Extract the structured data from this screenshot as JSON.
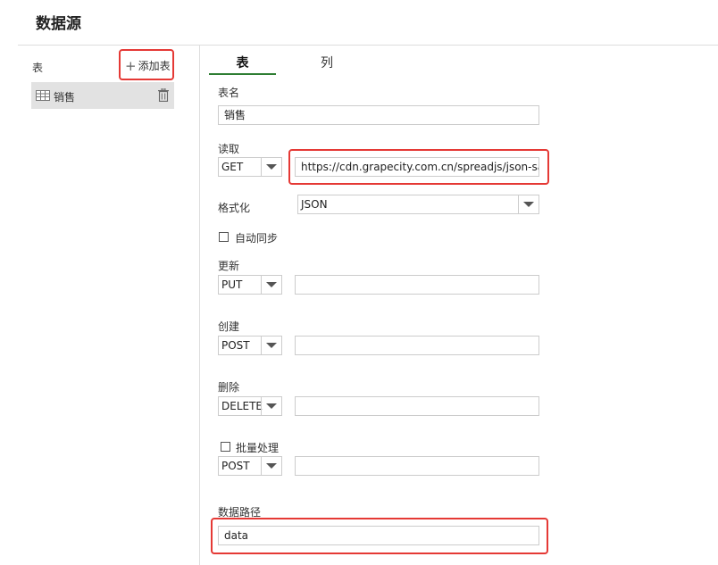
{
  "page": {
    "title": "数据源"
  },
  "sidebar": {
    "header_label": "表",
    "add_table_label": "添加表",
    "tables": [
      {
        "name": "销售"
      }
    ]
  },
  "tabs": [
    {
      "label": "表"
    },
    {
      "label": "列"
    }
  ],
  "form": {
    "table_name": {
      "label": "表名",
      "value": "销售"
    },
    "read": {
      "label": "读取",
      "method": "GET",
      "url": "https://cdn.grapecity.com.cn/spreadjs/json-sampl"
    },
    "format": {
      "label": "格式化",
      "value": "JSON"
    },
    "auto_sync": {
      "label": "自动同步",
      "checked": false
    },
    "update": {
      "label": "更新",
      "method": "PUT",
      "url": ""
    },
    "create": {
      "label": "创建",
      "method": "POST",
      "url": ""
    },
    "delete": {
      "label": "删除",
      "method": "DELETE",
      "url": ""
    },
    "batch": {
      "label": "批量处理",
      "checked": false,
      "method": "POST",
      "url": ""
    },
    "data_path": {
      "label": "数据路径",
      "value": "data"
    }
  },
  "colors": {
    "highlight": "#e53935",
    "tab_underline": "#2e7d32",
    "selected_row": "#e2e2e2"
  }
}
